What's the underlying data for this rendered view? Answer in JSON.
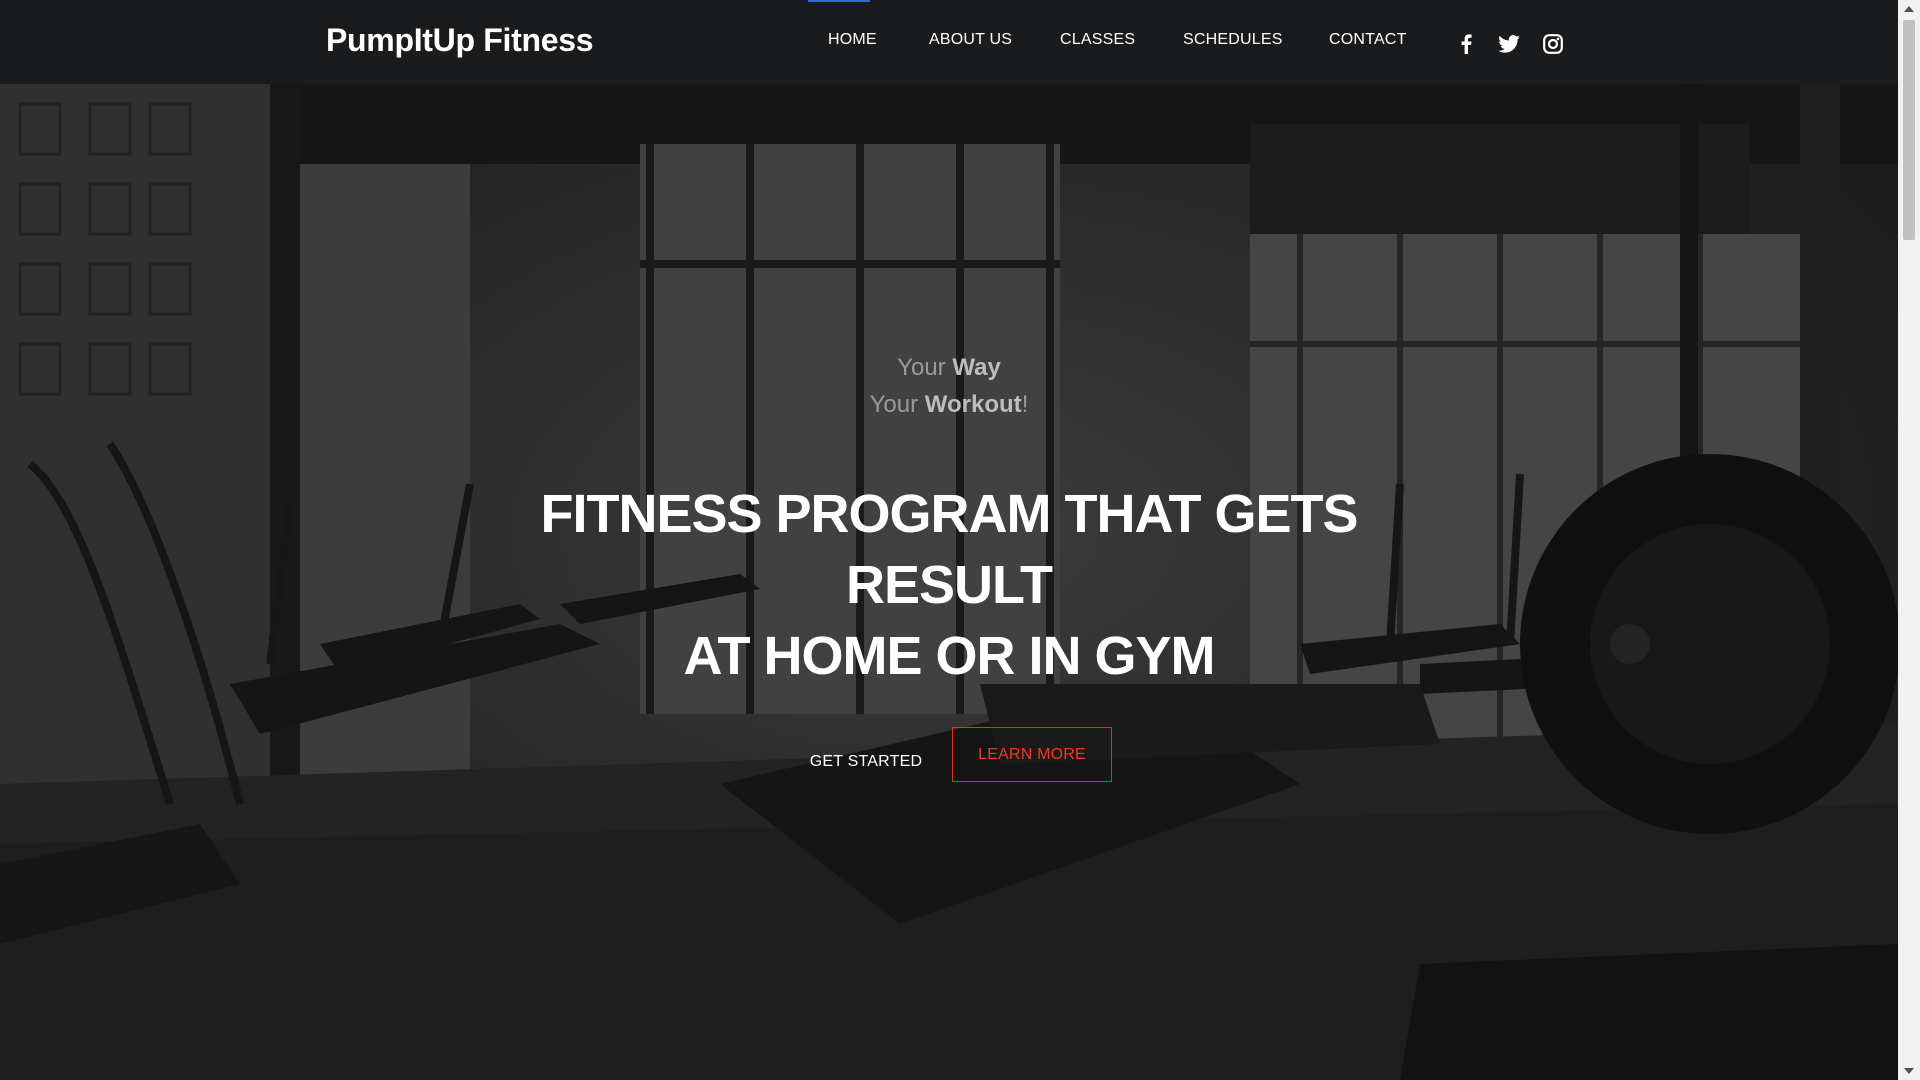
{
  "header": {
    "logo": "PumpItUp Fitness",
    "nav": [
      {
        "label": "HOME",
        "active": true
      },
      {
        "label": "ABOUT US",
        "active": false
      },
      {
        "label": "CLASSES",
        "active": false
      },
      {
        "label": "SCHEDULES",
        "active": false
      },
      {
        "label": "CONTACT",
        "active": false
      }
    ],
    "social": [
      "facebook-icon",
      "twitter-icon",
      "instagram-icon"
    ]
  },
  "hero": {
    "tagline_1_prefix": "Your",
    "tagline_1_bold": "Way",
    "tagline_2_prefix": "Your",
    "tagline_2_bold": "Workout",
    "tagline_2_suffix": "!",
    "headline_lines": [
      "FITNESS PROGRAM THAT GETS",
      "RESULT",
      "AT HOME OR IN GYM"
    ],
    "get_started_label": "GET STARTED",
    "learn_more_label": "LEARN MORE"
  },
  "colors": {
    "accent": "#ee3b24",
    "header_bg": "#1a1b1d",
    "active_indicator": "#2f6fd6"
  }
}
